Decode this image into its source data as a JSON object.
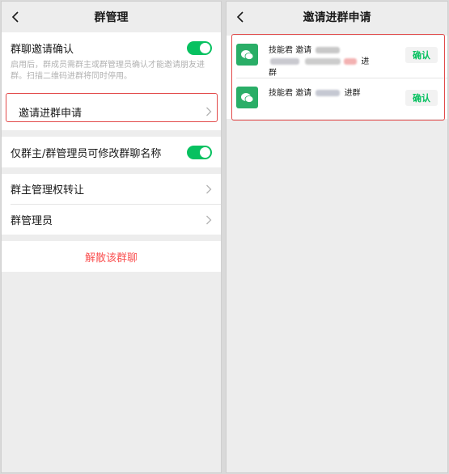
{
  "colors": {
    "accent_green": "#07c160",
    "danger_red": "#fa5151",
    "highlight_red": "#e24a4a",
    "avatar_green": "#2aae67"
  },
  "left": {
    "title": "群管理",
    "back_icon": "chevron-left-icon",
    "invite_confirm": {
      "label": "群聊邀请确认",
      "enabled": true,
      "description": "启用后，群成员需群主或群管理员确认才能邀请朋友进群。扫描二维码进群将同时停用。"
    },
    "join_requests_label": "邀请进群申请",
    "owner_admin_rename": {
      "label": "仅群主/群管理员可修改群聊名称",
      "enabled": true
    },
    "transfer_label": "群主管理权转让",
    "admins_label": "群管理员",
    "dissolve_label": "解散该群聊"
  },
  "right": {
    "title": "邀请进群申请",
    "back_icon": "chevron-left-icon",
    "requests": [
      {
        "inviter": "技能君",
        "verb": "邀请",
        "suffix": "进群",
        "confirm_label": "确认",
        "avatar_icon": "wechat-icon"
      },
      {
        "inviter": "技能君",
        "verb": "邀请",
        "suffix": "进群",
        "confirm_label": "确认",
        "avatar_icon": "wechat-icon"
      }
    ]
  }
}
